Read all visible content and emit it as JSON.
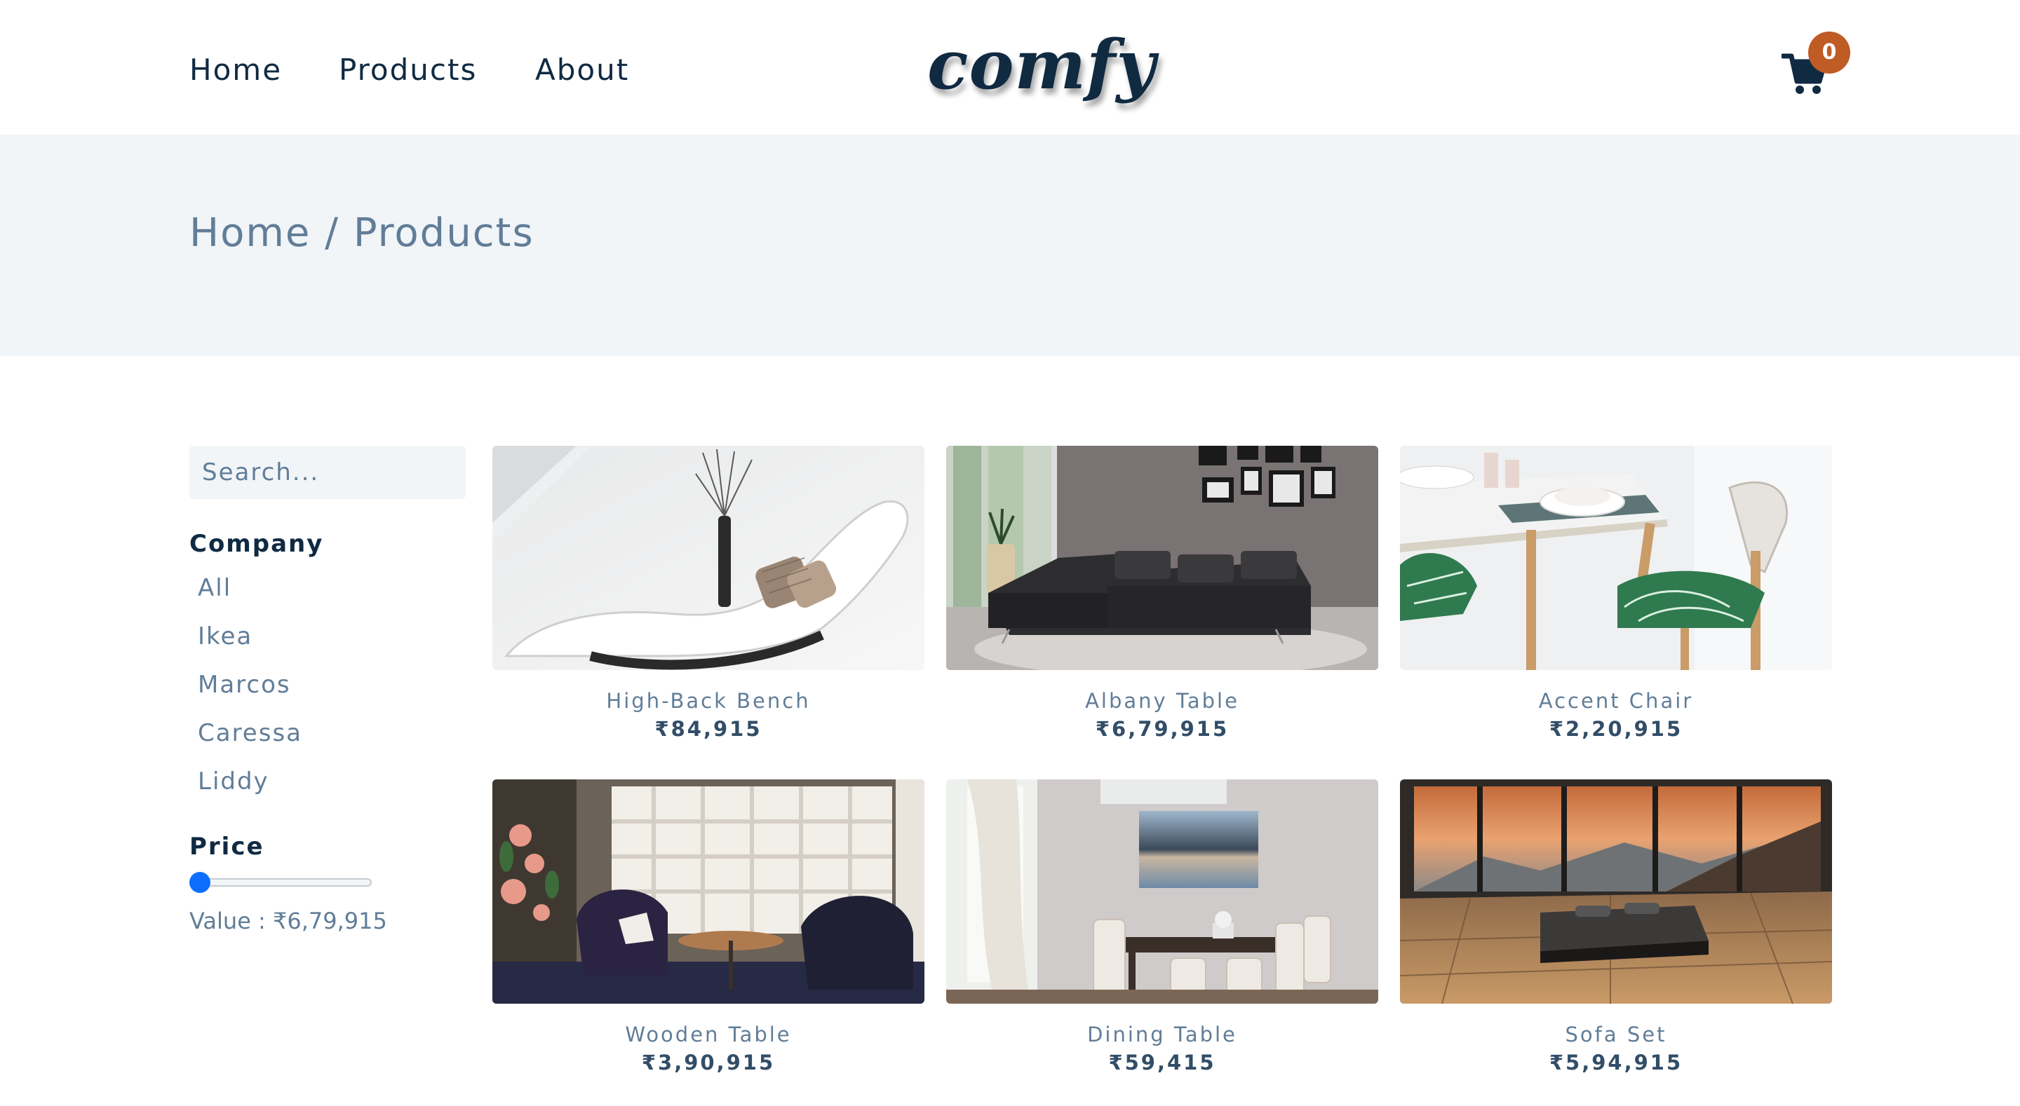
{
  "nav": {
    "links": [
      "Home",
      "Products",
      "About"
    ],
    "logo": "comfy",
    "cart_count": "0",
    "cart_icon": "shopping-cart-icon",
    "badge_color": "#bf5b25"
  },
  "hero": {
    "home": "Home",
    "separator": " / ",
    "current": "Products"
  },
  "filters": {
    "search_placeholder": "Search...",
    "company_heading": "Company",
    "companies": [
      "All",
      "Ikea",
      "Marcos",
      "Caressa",
      "Liddy"
    ],
    "price_heading": "Price",
    "price_label": "Value : ₹6,79,915",
    "price_fraction": 0.0
  },
  "products": [
    {
      "name": "High-Back Bench",
      "price": "₹84,915"
    },
    {
      "name": "Albany Table",
      "price": "₹6,79,915"
    },
    {
      "name": "Accent Chair",
      "price": "₹2,20,915"
    },
    {
      "name": "Wooden Table",
      "price": "₹3,90,915"
    },
    {
      "name": "Dining Table",
      "price": "₹59,415"
    },
    {
      "name": "Sofa Set",
      "price": "₹5,94,915"
    }
  ],
  "colors": {
    "text_dark": "#102a42",
    "text_muted": "#617d98",
    "hero_bg": "#f1f5f8",
    "slider_thumb": "#0d6efd"
  }
}
